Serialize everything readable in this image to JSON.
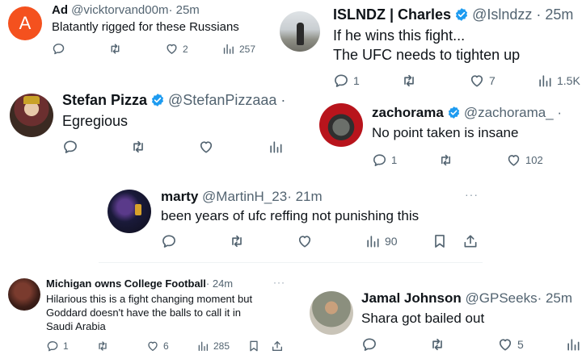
{
  "tweets": {
    "ad": {
      "name": "Ad",
      "handle": "@vicktorvand00m",
      "time": "· 25m",
      "avatar_letter": "A",
      "text": "Blatantly rigged for these Russians",
      "likes": "2",
      "views": "257"
    },
    "islndz": {
      "name": "ISLNDZ | Charles",
      "handle": "@Islndzz",
      "time": "· 25m",
      "text_line1": "If he wins this fight...",
      "text_line2": "The UFC needs to tighten up",
      "replies": "1",
      "likes": "7",
      "views": "1.5K"
    },
    "stefan": {
      "name": "Stefan Pizza",
      "handle": "@StefanPizzaaa ·",
      "text": "Egregious"
    },
    "zacho": {
      "name": "zachorama",
      "handle": "@zachorama_ ·",
      "text": "No point taken is insane",
      "replies": "1",
      "likes": "102"
    },
    "marty": {
      "name": "marty",
      "handle": "@MartinH_23",
      "time": "· 21m",
      "text": "been years of ufc reffing not punishing this",
      "views": "90",
      "more": "···"
    },
    "michigan": {
      "name": "Michigan owns College Football",
      "time": "· 24m",
      "more": "···",
      "text_line1": "Hilarious this is a fight changing moment but",
      "text_line2": "Goddard doesn't have the balls to call it in",
      "text_line3": "Saudi Arabia",
      "replies": "1",
      "likes": "6",
      "views": "285"
    },
    "jamal": {
      "name": "Jamal Johnson",
      "handle": "@GPSeeks",
      "time": "· 25m",
      "text": "Shara got bailed out",
      "likes": "5"
    }
  },
  "colors": {
    "ad_avatar": "#f4511e",
    "verified": "#1d9bf0",
    "icon_gray": "#536471"
  },
  "icons": [
    "reply-icon",
    "retweet-icon",
    "like-icon",
    "views-icon",
    "bookmark-icon",
    "share-icon",
    "verified-icon"
  ]
}
